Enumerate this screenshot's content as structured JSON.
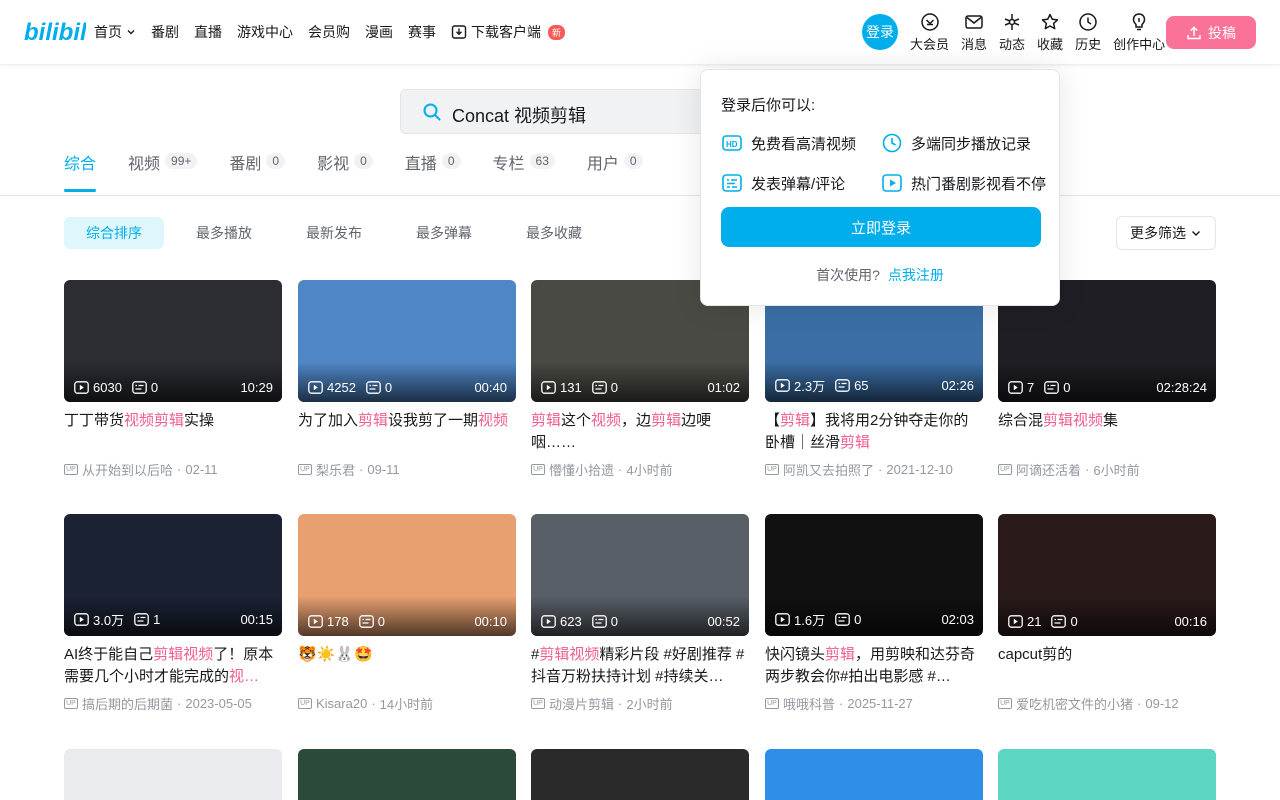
{
  "header": {
    "nav": [
      "首页",
      "番剧",
      "直播",
      "游戏中心",
      "会员购",
      "漫画",
      "赛事",
      "下载客户端"
    ],
    "new_badge": "新",
    "login": "登录",
    "icons": [
      {
        "label": "大会员",
        "icon": "vip-icon"
      },
      {
        "label": "消息",
        "icon": "message-icon"
      },
      {
        "label": "动态",
        "icon": "dynamic-icon"
      },
      {
        "label": "收藏",
        "icon": "favorite-icon"
      },
      {
        "label": "历史",
        "icon": "history-icon"
      },
      {
        "label": "创作中心",
        "icon": "creator-icon"
      }
    ],
    "upload": "投稿"
  },
  "search": {
    "query": "Concat 视频剪辑"
  },
  "tabs": [
    {
      "label": "综合",
      "count": ""
    },
    {
      "label": "视频",
      "count": "99+"
    },
    {
      "label": "番剧",
      "count": "0"
    },
    {
      "label": "影视",
      "count": "0"
    },
    {
      "label": "直播",
      "count": "0"
    },
    {
      "label": "专栏",
      "count": "63"
    },
    {
      "label": "用户",
      "count": "0"
    }
  ],
  "filters": [
    "综合排序",
    "最多播放",
    "最新发布",
    "最多弹幕",
    "最多收藏"
  ],
  "more_filter": "更多筛选",
  "popup": {
    "title": "登录后你可以:",
    "features": [
      "免费看高清视频",
      "多端同步播放记录",
      "发表弹幕/评论",
      "热门番剧影视看不停"
    ],
    "login_button": "立即登录",
    "first_use": "首次使用?",
    "register": "点我注册"
  },
  "videos": [
    {
      "views": "6030",
      "danmaku": "0",
      "duration": "10:29",
      "title": [
        "丁丁带货",
        "视频剪辑",
        "实操"
      ],
      "author": "从开始到以后哈",
      "date": "02-11",
      "bg": "#2b2d33"
    },
    {
      "views": "4252",
      "danmaku": "0",
      "duration": "00:40",
      "title": [
        "为了加入",
        "剪辑",
        "设我剪了一期",
        "视频"
      ],
      "author": "梨乐君",
      "date": "09-11",
      "bg": "#4f86c6"
    },
    {
      "views": "131",
      "danmaku": "0",
      "duration": "01:02",
      "title": [
        "",
        "剪辑",
        "这个",
        "视频",
        "，边",
        "剪辑",
        "边哽咽……"
      ],
      "author": "懵懂小拾遗",
      "date": "4小时前",
      "bg": "#4a4a44"
    },
    {
      "views": "2.3万",
      "danmaku": "65",
      "duration": "02:26",
      "title": [
        "【",
        "剪辑",
        "】我将用2分钟夺走你的卧槽｜丝滑",
        "剪辑"
      ],
      "author": "阿凯又去拍照了",
      "date": "2021-12-10",
      "bg": "#3a6ea5"
    },
    {
      "views": "7",
      "danmaku": "0",
      "duration": "02:28:24",
      "title": [
        "综合混",
        "剪辑视频",
        "集"
      ],
      "author": "阿谪还活着",
      "date": "6小时前",
      "bg": "#1e1e24"
    },
    {
      "views": "3.0万",
      "danmaku": "1",
      "duration": "00:15",
      "title": [
        "AI终于能自己",
        "剪辑视频",
        "了！原本需要几个小时才能完成的",
        "视…"
      ],
      "author": "搞后期的后期菌",
      "date": "2023-05-05",
      "bg": "#1b2233"
    },
    {
      "views": "178",
      "danmaku": "0",
      "duration": "00:10",
      "title": [
        "🐯☀️🐰🤩"
      ],
      "author": "Kisara20",
      "date": "14小时前",
      "bg": "#e8a070"
    },
    {
      "views": "623",
      "danmaku": "0",
      "duration": "00:52",
      "title": [
        "#",
        "剪辑视频",
        "精彩片段 #好剧推荐 #抖音万粉扶持计划 #持续关…"
      ],
      "author": "动漫片剪辑",
      "date": "2小时前",
      "bg": "#585f66"
    },
    {
      "views": "1.6万",
      "danmaku": "0",
      "duration": "02:03",
      "title": [
        "快闪镜头",
        "剪辑",
        "，用剪映和达芬奇两步教会你#拍出电影感 #…"
      ],
      "author": "哦哦科普",
      "date": "2025-11-27",
      "bg": "#111111"
    },
    {
      "views": "21",
      "danmaku": "0",
      "duration": "00:16",
      "title": [
        "capcut剪的"
      ],
      "author": "爱吃机密文件的小猪",
      "date": "09-12",
      "bg": "#2a1a1a"
    }
  ],
  "bottom_thumbs": [
    "#e9ebee",
    "#2c4a3a",
    "#2a2a2a",
    "#2f8fe8",
    "#5cd6c2"
  ]
}
